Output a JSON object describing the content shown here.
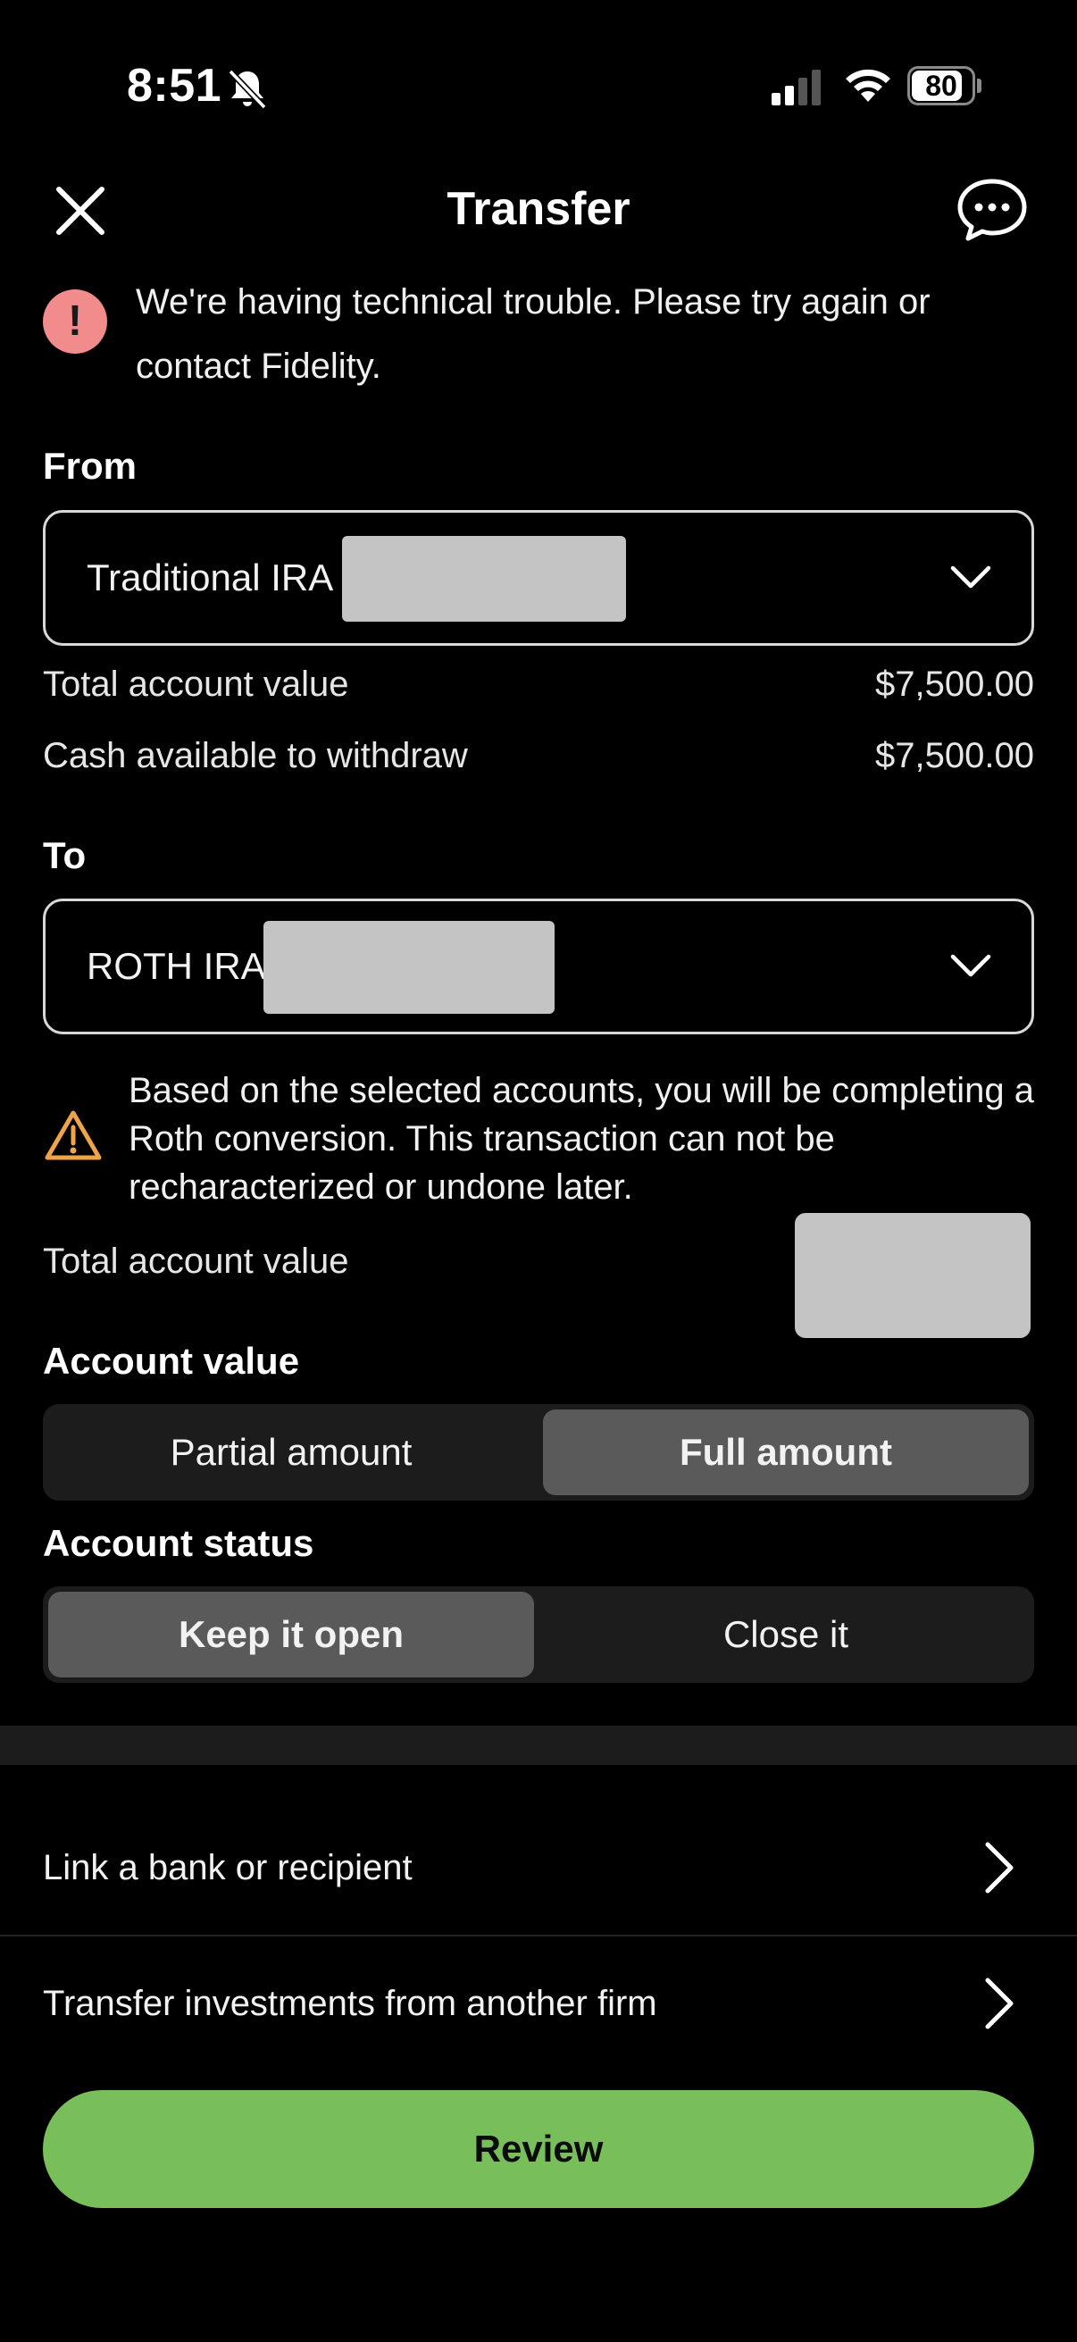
{
  "status_bar": {
    "time": "8:51",
    "battery": "80",
    "battery_level": 0.8
  },
  "header": {
    "title": "Transfer"
  },
  "error": {
    "message": "We're having technical trouble. Please try again or contact Fidelity.",
    "icon_glyph": "!",
    "color": "#f28b8b"
  },
  "from": {
    "label": "From",
    "account": "Traditional IRA",
    "total_label": "Total account value",
    "total_value": "$7,500.00",
    "cash_label": "Cash available to withdraw",
    "cash_value": "$7,500.00"
  },
  "to": {
    "label": "To",
    "account": "ROTH IRA",
    "warning": "Based on the selected accounts, you will be completing a Roth conversion. This transaction can not be recharacterized or undone later.",
    "total_label": "Total account value"
  },
  "account_value": {
    "label": "Account value",
    "options": [
      "Partial amount",
      "Full amount"
    ],
    "selected": "Full amount"
  },
  "account_status": {
    "label": "Account status",
    "options": [
      "Keep it open",
      "Close it"
    ],
    "selected": "Keep it open"
  },
  "links": [
    {
      "label": "Link a bank or recipient"
    },
    {
      "label": "Transfer investments from another firm"
    }
  ],
  "review_button": "Review",
  "colors": {
    "accent_green": "#78be5a",
    "warning_orange": "#f0a44a",
    "error_pink": "#f28b8b"
  }
}
